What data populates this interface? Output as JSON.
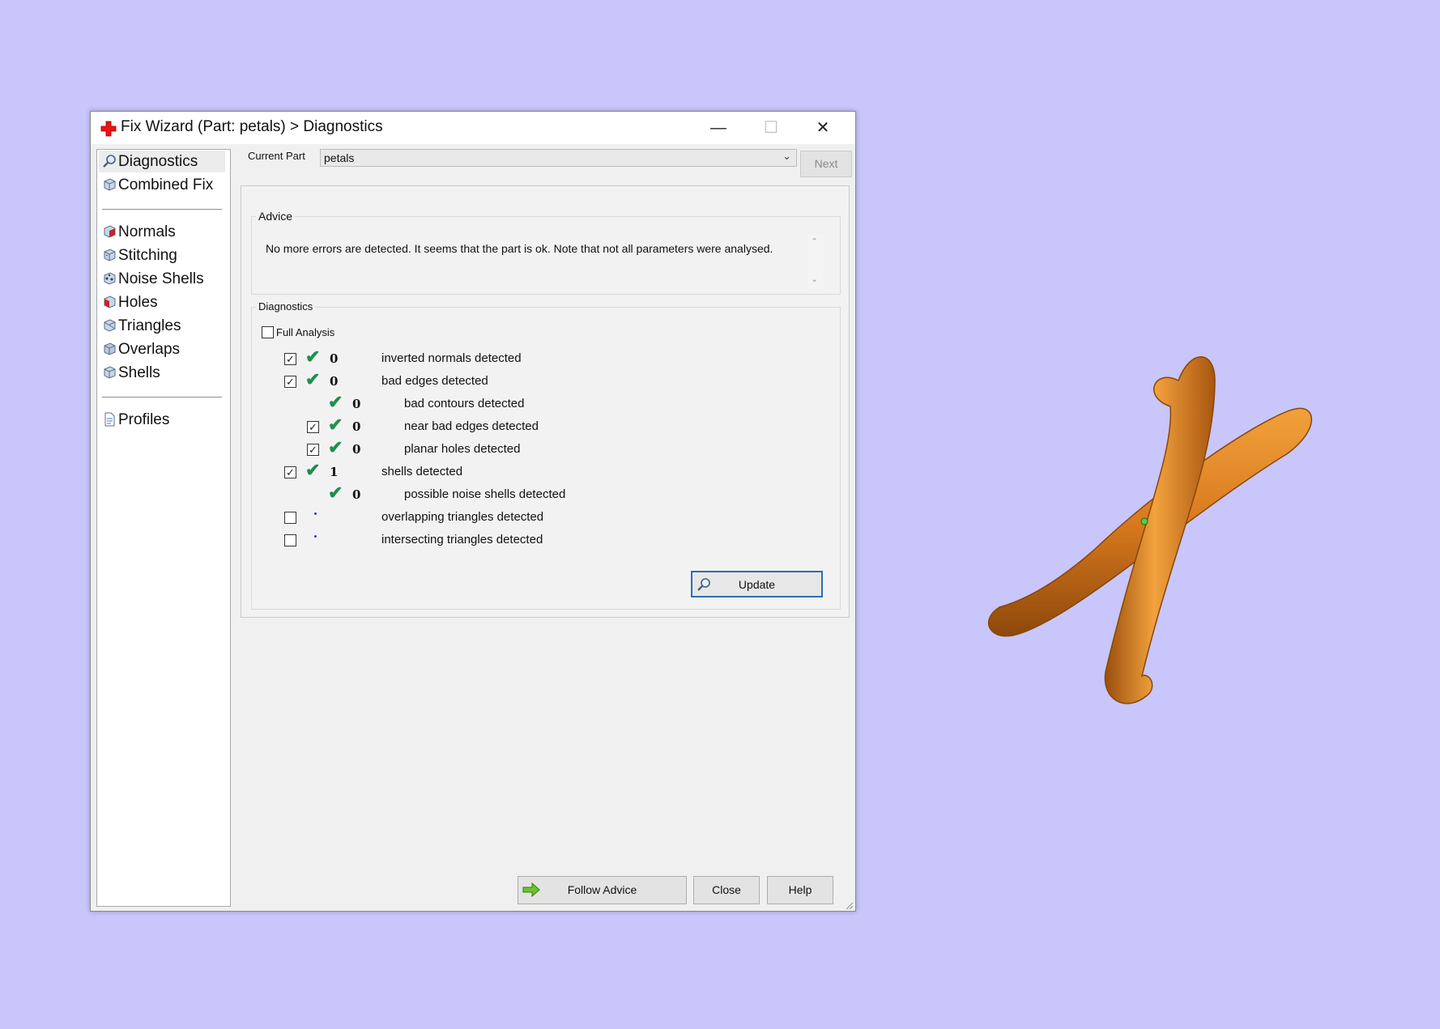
{
  "window": {
    "title": "Fix Wizard (Part: petals) > Diagnostics",
    "controls": {
      "minimize": "—",
      "maximize": "☐",
      "close": "✕"
    }
  },
  "sidebar": {
    "group1": [
      {
        "label": "Diagnostics",
        "icon": "magnifier-icon",
        "selected": true
      },
      {
        "label": "Combined Fix",
        "icon": "cube-icon"
      }
    ],
    "group2": [
      {
        "label": "Normals",
        "icon": "normals-cube-icon"
      },
      {
        "label": "Stitching",
        "icon": "stitching-cube-icon"
      },
      {
        "label": "Noise Shells",
        "icon": "noise-shells-cube-icon"
      },
      {
        "label": "Holes",
        "icon": "holes-cube-icon"
      },
      {
        "label": "Triangles",
        "icon": "triangles-cube-icon"
      },
      {
        "label": "Overlaps",
        "icon": "overlaps-cube-icon"
      },
      {
        "label": "Shells",
        "icon": "shells-cube-icon"
      }
    ],
    "group3": [
      {
        "label": "Profiles",
        "icon": "profile-document-icon"
      }
    ]
  },
  "current_part": {
    "label": "Current Part",
    "value": "petals"
  },
  "next_label": "Next",
  "advice": {
    "title": "Advice",
    "text": "No more errors are detected. It seems that the part is ok. Note that not all parameters were analysed."
  },
  "diagnostics": {
    "title": "Diagnostics",
    "full_analysis_label": "Full Analysis",
    "rows": [
      {
        "checkbox": true,
        "checked": true,
        "status": "ok",
        "count": "0",
        "label": "inverted normals detected",
        "indent": 0
      },
      {
        "checkbox": true,
        "checked": true,
        "status": "ok",
        "count": "0",
        "label": "bad edges detected",
        "indent": 0
      },
      {
        "checkbox": false,
        "checked": false,
        "status": "ok",
        "count": "0",
        "label": "bad contours detected",
        "indent": 1
      },
      {
        "checkbox": true,
        "checked": true,
        "status": "ok",
        "count": "0",
        "label": "near bad edges detected",
        "indent": 1
      },
      {
        "checkbox": true,
        "checked": true,
        "status": "ok",
        "count": "0",
        "label": "planar holes detected",
        "indent": 1
      },
      {
        "checkbox": true,
        "checked": true,
        "status": "ok",
        "count": "1",
        "label": "shells detected",
        "indent": 0
      },
      {
        "checkbox": false,
        "checked": false,
        "status": "ok",
        "count": "0",
        "label": "possible noise shells detected",
        "indent": 1
      },
      {
        "checkbox": true,
        "checked": false,
        "status": "not-analysed",
        "count": "",
        "label": "overlapping triangles detected",
        "indent": 0
      },
      {
        "checkbox": true,
        "checked": false,
        "status": "not-analysed",
        "count": "",
        "label": "intersecting triangles detected",
        "indent": 0
      }
    ],
    "update_label": "Update"
  },
  "footer": {
    "follow_advice_label": "Follow Advice",
    "close_label": "Close",
    "help_label": "Help"
  },
  "colors": {
    "desktop": "#c8c6fb",
    "check": "#1e8f4e",
    "model": "#e0821f",
    "update_border": "#2a6fb8"
  }
}
